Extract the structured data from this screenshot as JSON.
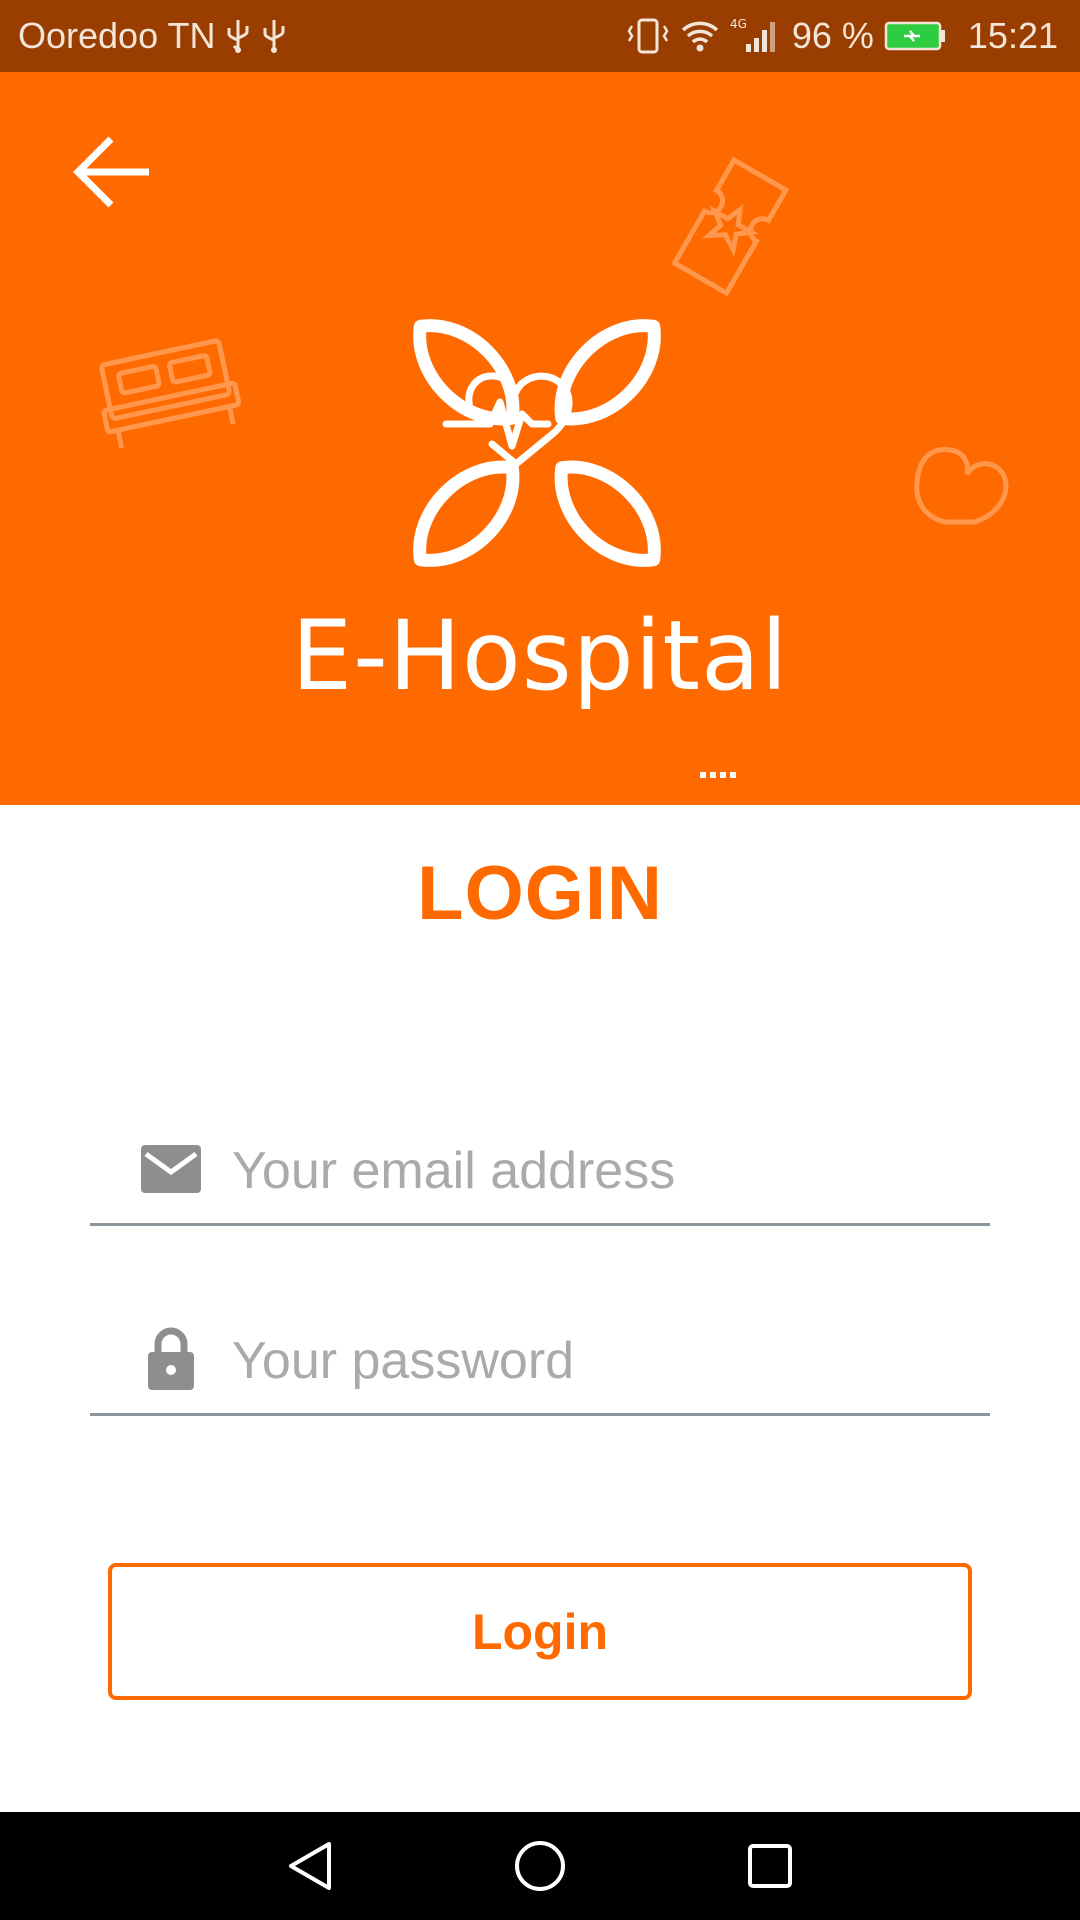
{
  "status_bar": {
    "carrier": "Ooredoo TN",
    "battery_percent": "96 %",
    "time": "15:21",
    "icons": [
      "usb-icon",
      "usb-icon",
      "vibrate-icon",
      "wifi-icon",
      "signal-4g-icon",
      "battery-charging-icon"
    ]
  },
  "header": {
    "back_icon": "arrow-left-icon",
    "brand_name": "E-Hospital",
    "decorative_icons": [
      "bed-icon",
      "ticket-icon",
      "heart-icon"
    ]
  },
  "login": {
    "title": "LOGIN",
    "email": {
      "placeholder": "Your email address",
      "value": "",
      "icon": "envelope-icon"
    },
    "password": {
      "placeholder": "Your password",
      "value": "",
      "icon": "lock-icon"
    },
    "button_label": "Login"
  },
  "nav_bar": {
    "buttons": [
      "back-triangle-icon",
      "home-circle-icon",
      "recents-square-icon"
    ]
  },
  "colors": {
    "status_bar": "#993d00",
    "accent": "#ff6a00",
    "field_underline": "#8a959c",
    "placeholder": "#aaaaaa"
  }
}
